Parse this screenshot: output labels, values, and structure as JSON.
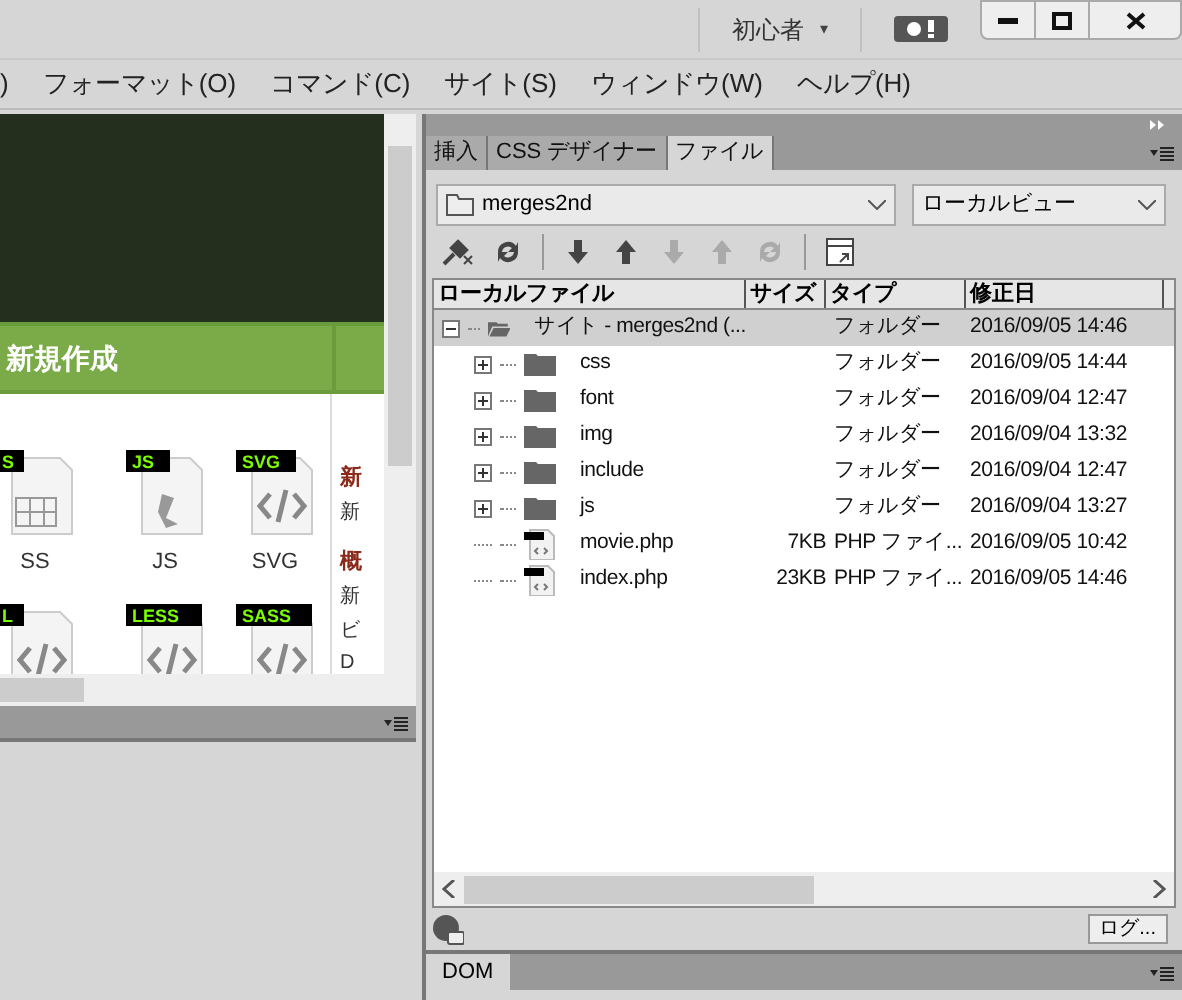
{
  "title_bar": {
    "workspace": "初心者",
    "caret": "▾"
  },
  "menu": [
    ")",
    "フォーマット(O)",
    "コマンド(C)",
    "サイト(S)",
    "ウィンドウ(W)",
    "ヘルプ(H)"
  ],
  "start_screen": {
    "header": "新規作成",
    "file_types": [
      {
        "badge": "S",
        "label": "SS",
        "kind": "grid"
      },
      {
        "badge": "JS",
        "label": "JS",
        "kind": "script"
      },
      {
        "badge": "SVG",
        "label": "SVG",
        "kind": "code"
      },
      {
        "badge": "L",
        "kind": "code"
      },
      {
        "badge": "LESS",
        "kind": "code"
      },
      {
        "badge": "SASS",
        "kind": "code"
      }
    ],
    "side_text": [
      {
        "text": "新",
        "kind": "heading"
      },
      {
        "text": "新",
        "kind": "body"
      },
      {
        "text": "概",
        "kind": "heading"
      },
      {
        "text": "新",
        "kind": "body"
      },
      {
        "text": "ビ",
        "kind": "body"
      },
      {
        "text": "D",
        "kind": "body"
      }
    ]
  },
  "files_panel": {
    "tabs": [
      {
        "label": "挿入",
        "selected": false
      },
      {
        "label": "CSS デザイナー",
        "selected": false
      },
      {
        "label": "ファイル",
        "selected": true
      }
    ],
    "site": "merges2nd",
    "view": "ローカルビュー",
    "columns": [
      "ローカルファイル",
      "サイズ",
      "タイプ",
      "修正日"
    ],
    "tree": [
      {
        "name": "サイト - merges2nd (...",
        "type": "フォルダー",
        "modified": "2016/09/05 14:46",
        "kind": "site",
        "selected": true,
        "expanded": true,
        "children": [
          {
            "name": "css",
            "type": "フォルダー",
            "modified": "2016/09/05 14:44",
            "kind": "folder",
            "selected": false,
            "expanded": false
          },
          {
            "name": "font",
            "type": "フォルダー",
            "modified": "2016/09/04 12:47",
            "kind": "folder",
            "selected": false,
            "expanded": false
          },
          {
            "name": "img",
            "type": "フォルダー",
            "modified": "2016/09/04 13:32",
            "kind": "folder",
            "selected": false,
            "expanded": false
          },
          {
            "name": "include",
            "type": "フォルダー",
            "modified": "2016/09/04 12:47",
            "kind": "folder",
            "selected": false,
            "expanded": false
          },
          {
            "name": "js",
            "type": "フォルダー",
            "modified": "2016/09/04 13:27",
            "kind": "folder",
            "selected": false,
            "expanded": false
          },
          {
            "name": "movie.php",
            "size": "7KB",
            "type": "PHP ファイ...",
            "modified": "2016/09/05 10:42",
            "kind": "file",
            "selected": false
          },
          {
            "name": "index.php",
            "size": "23KB",
            "type": "PHP ファイ...",
            "modified": "2016/09/05 14:46",
            "kind": "file",
            "selected": false
          }
        ]
      }
    ],
    "log_button": "ログ..."
  },
  "bottom_tab": "DOM"
}
